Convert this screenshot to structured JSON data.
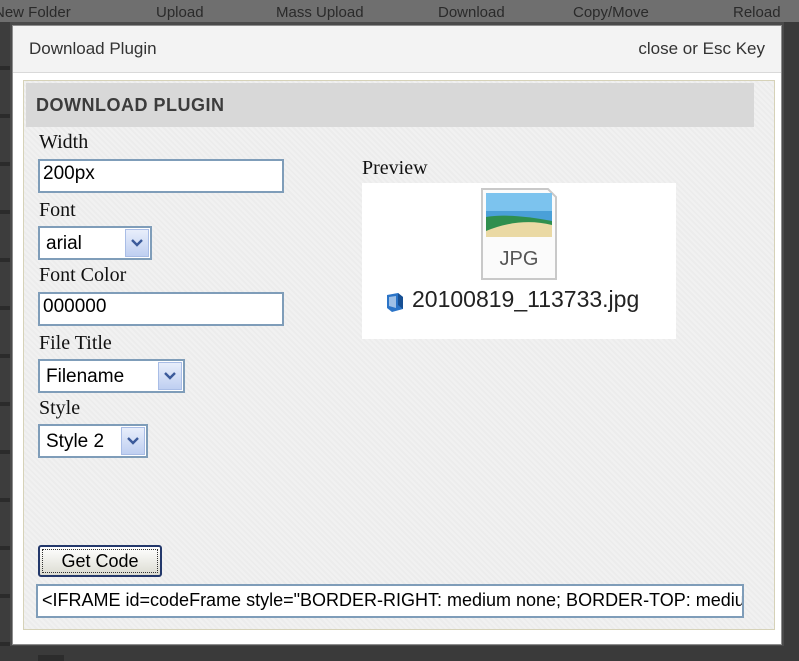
{
  "background": {
    "nav_items": [
      "New Folder",
      "Upload",
      "Mass Upload",
      "Download",
      "Copy/Move",
      "Reload"
    ]
  },
  "dialog": {
    "title": "Download Plugin",
    "close_label": "close or Esc Key"
  },
  "panel": {
    "heading": "DOWNLOAD PLUGIN",
    "width": {
      "label": "Width",
      "value": "200px"
    },
    "font": {
      "label": "Font",
      "selected": "arial"
    },
    "font_color": {
      "label": "Font Color",
      "value": "000000"
    },
    "file_title": {
      "label": "File Title",
      "selected": "Filename"
    },
    "style": {
      "label": "Style",
      "selected": "Style 2"
    },
    "get_code_label": "Get Code",
    "code_value": "<IFRAME id=codeFrame style=\"BORDER-RIGHT: medium none; BORDER-TOP: medium none;"
  },
  "preview": {
    "label": "Preview",
    "icon_text": "JPG",
    "filename": "20100819_113733.jpg"
  },
  "colors": {
    "input_border": "#7f9db9",
    "panel_header": "#d8d8d8",
    "button_border": "#23386b"
  }
}
